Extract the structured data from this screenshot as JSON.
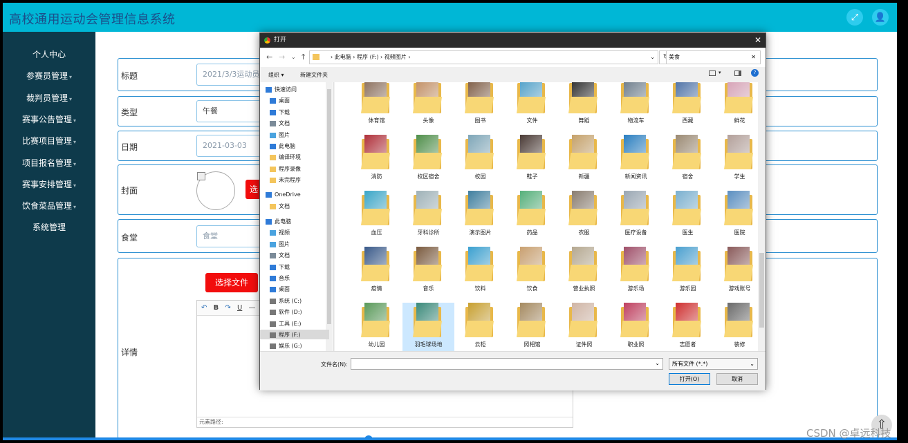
{
  "app": {
    "title": "高校通用运动会管理信息系统"
  },
  "sidebar": {
    "items": [
      {
        "label": "个人中心",
        "arrow": ""
      },
      {
        "label": "参赛员管理",
        "arrow": "▾"
      },
      {
        "label": "裁判员管理",
        "arrow": "▾"
      },
      {
        "label": "赛事公告管理",
        "arrow": "▾"
      },
      {
        "label": "比赛项目管理",
        "arrow": "▾"
      },
      {
        "label": "项目报名管理",
        "arrow": "▾"
      },
      {
        "label": "赛事安排管理",
        "arrow": "▾"
      },
      {
        "label": "饮食菜品管理",
        "arrow": "▾"
      },
      {
        "label": "系统管理",
        "arrow": ""
      }
    ]
  },
  "form": {
    "title_label": "标题",
    "title_value": "2021/3/3运动员饮食",
    "type_label": "类型",
    "type_value": "午餐",
    "date_label": "日期",
    "date_value": "2021-03-03",
    "cover_label": "封面",
    "cover_button": "选择文件",
    "canteen_label": "食堂",
    "canteen_value": "食堂",
    "detail_label": "详情",
    "detail_button": "选择文件",
    "editor_path": "元素路径:"
  },
  "dialog": {
    "title": "打开",
    "breadcrumb": "›  此电脑  ›  程序 (F:)  ›  视频图片  ›",
    "search_value": "美食",
    "cmd_organize": "组织 ▾",
    "cmd_new_folder": "新建文件夹",
    "nav": [
      {
        "label": "快速访问",
        "icon": "star-icon",
        "color": "#2f7bd8"
      },
      {
        "label": "桌面",
        "icon": "desktop-icon",
        "color": "#2f7bd8"
      },
      {
        "label": "下载",
        "icon": "download-icon",
        "color": "#2f7bd8"
      },
      {
        "label": "文档",
        "icon": "document-icon",
        "color": "#7b8b99"
      },
      {
        "label": "图片",
        "icon": "picture-icon",
        "color": "#4aa3df"
      },
      {
        "label": "此电脑",
        "icon": "computer-icon",
        "color": "#2f7bd8"
      },
      {
        "label": "编译环境",
        "icon": "folder-icon",
        "color": "#f4c55c"
      },
      {
        "label": "程序录像",
        "icon": "folder-icon",
        "color": "#f4c55c"
      },
      {
        "label": "未完程序",
        "icon": "folder-icon",
        "color": "#f4c55c"
      },
      {
        "label": "OneDrive",
        "icon": "cloud-icon",
        "color": "#2f7bd8"
      },
      {
        "label": "文档",
        "icon": "folder-icon",
        "color": "#f4c55c"
      },
      {
        "label": "此电脑",
        "icon": "computer-icon",
        "color": "#2f7bd8"
      },
      {
        "label": "视频",
        "icon": "video-icon",
        "color": "#4aa3df"
      },
      {
        "label": "图片",
        "icon": "picture-icon",
        "color": "#4aa3df"
      },
      {
        "label": "文档",
        "icon": "document-icon",
        "color": "#7b8b99"
      },
      {
        "label": "下载",
        "icon": "download-icon",
        "color": "#2f7bd8"
      },
      {
        "label": "音乐",
        "icon": "music-icon",
        "color": "#2f7bd8"
      },
      {
        "label": "桌面",
        "icon": "desktop-icon",
        "color": "#2f7bd8"
      },
      {
        "label": "系统 (C:)",
        "icon": "drive-icon",
        "color": "#777"
      },
      {
        "label": "软件 (D:)",
        "icon": "drive-icon",
        "color": "#777"
      },
      {
        "label": "工具 (E:)",
        "icon": "drive-icon",
        "color": "#777"
      },
      {
        "label": "程序 (F:)",
        "icon": "drive-icon",
        "color": "#777"
      },
      {
        "label": "娱乐 (G:)",
        "icon": "drive-icon",
        "color": "#777"
      }
    ],
    "folders": [
      {
        "label": "体育馆",
        "color": "#8a6d5a"
      },
      {
        "label": "头像",
        "color": "#c28e62"
      },
      {
        "label": "图书",
        "color": "#7d5b43"
      },
      {
        "label": "文件",
        "color": "#4fa0c9"
      },
      {
        "label": "舞蹈",
        "color": "#2b2b2b"
      },
      {
        "label": "物流车",
        "color": "#6b7b8a"
      },
      {
        "label": "西藏",
        "color": "#4a6fa5"
      },
      {
        "label": "鲜花",
        "color": "#d6a0b5"
      },
      {
        "label": "消防",
        "color": "#b0303a"
      },
      {
        "label": "校区宿舍",
        "color": "#4f8f4a"
      },
      {
        "label": "校园",
        "color": "#7ea6b8"
      },
      {
        "label": "鞋子",
        "color": "#4a3a35"
      },
      {
        "label": "新疆",
        "color": "#c5a16a"
      },
      {
        "label": "新闻资讯",
        "color": "#2a7fc1"
      },
      {
        "label": "宿舍",
        "color": "#9b8a73"
      },
      {
        "label": "学生",
        "color": "#b3a09a"
      },
      {
        "label": "血压",
        "color": "#3aa6c8"
      },
      {
        "label": "牙科诊所",
        "color": "#9fb2b8"
      },
      {
        "label": "演示图片",
        "color": "#3f7f9f"
      },
      {
        "label": "药品",
        "color": "#55b07a"
      },
      {
        "label": "衣服",
        "color": "#8a7d70"
      },
      {
        "label": "医疗设备",
        "color": "#9aa7b3"
      },
      {
        "label": "医生",
        "color": "#7ab0d0"
      },
      {
        "label": "医院",
        "color": "#5b8fc1"
      },
      {
        "label": "疫情",
        "color": "#3a5a8a"
      },
      {
        "label": "音乐",
        "color": "#7b5b3f"
      },
      {
        "label": "饮料",
        "color": "#3aa0d0"
      },
      {
        "label": "饮食",
        "color": "#c9a070"
      },
      {
        "label": "营业执照",
        "color": "#b5a890"
      },
      {
        "label": "游乐场",
        "color": "#a0506a"
      },
      {
        "label": "游乐园",
        "color": "#4aa0d0"
      },
      {
        "label": "游戏账号",
        "color": "#8a5a5a"
      },
      {
        "label": "幼儿园",
        "color": "#5a9a5a"
      },
      {
        "label": "羽毛球场地",
        "color": "#3a8a7a"
      },
      {
        "label": "云柜",
        "color": "#c8a030"
      },
      {
        "label": "照相馆",
        "color": "#a58a60"
      },
      {
        "label": "证件照",
        "color": "#d0b5a5"
      },
      {
        "label": "职业照",
        "color": "#c04060"
      },
      {
        "label": "志愿者",
        "color": "#d03030"
      },
      {
        "label": "装修",
        "color": "#6a6a6a"
      }
    ],
    "selected_index": 33,
    "filename_label": "文件名(N):",
    "filetype_value": "所有文件 (*.*)",
    "open_label": "打开(O)",
    "cancel_label": "取消"
  },
  "watermark": "CSDN @卓远科技"
}
